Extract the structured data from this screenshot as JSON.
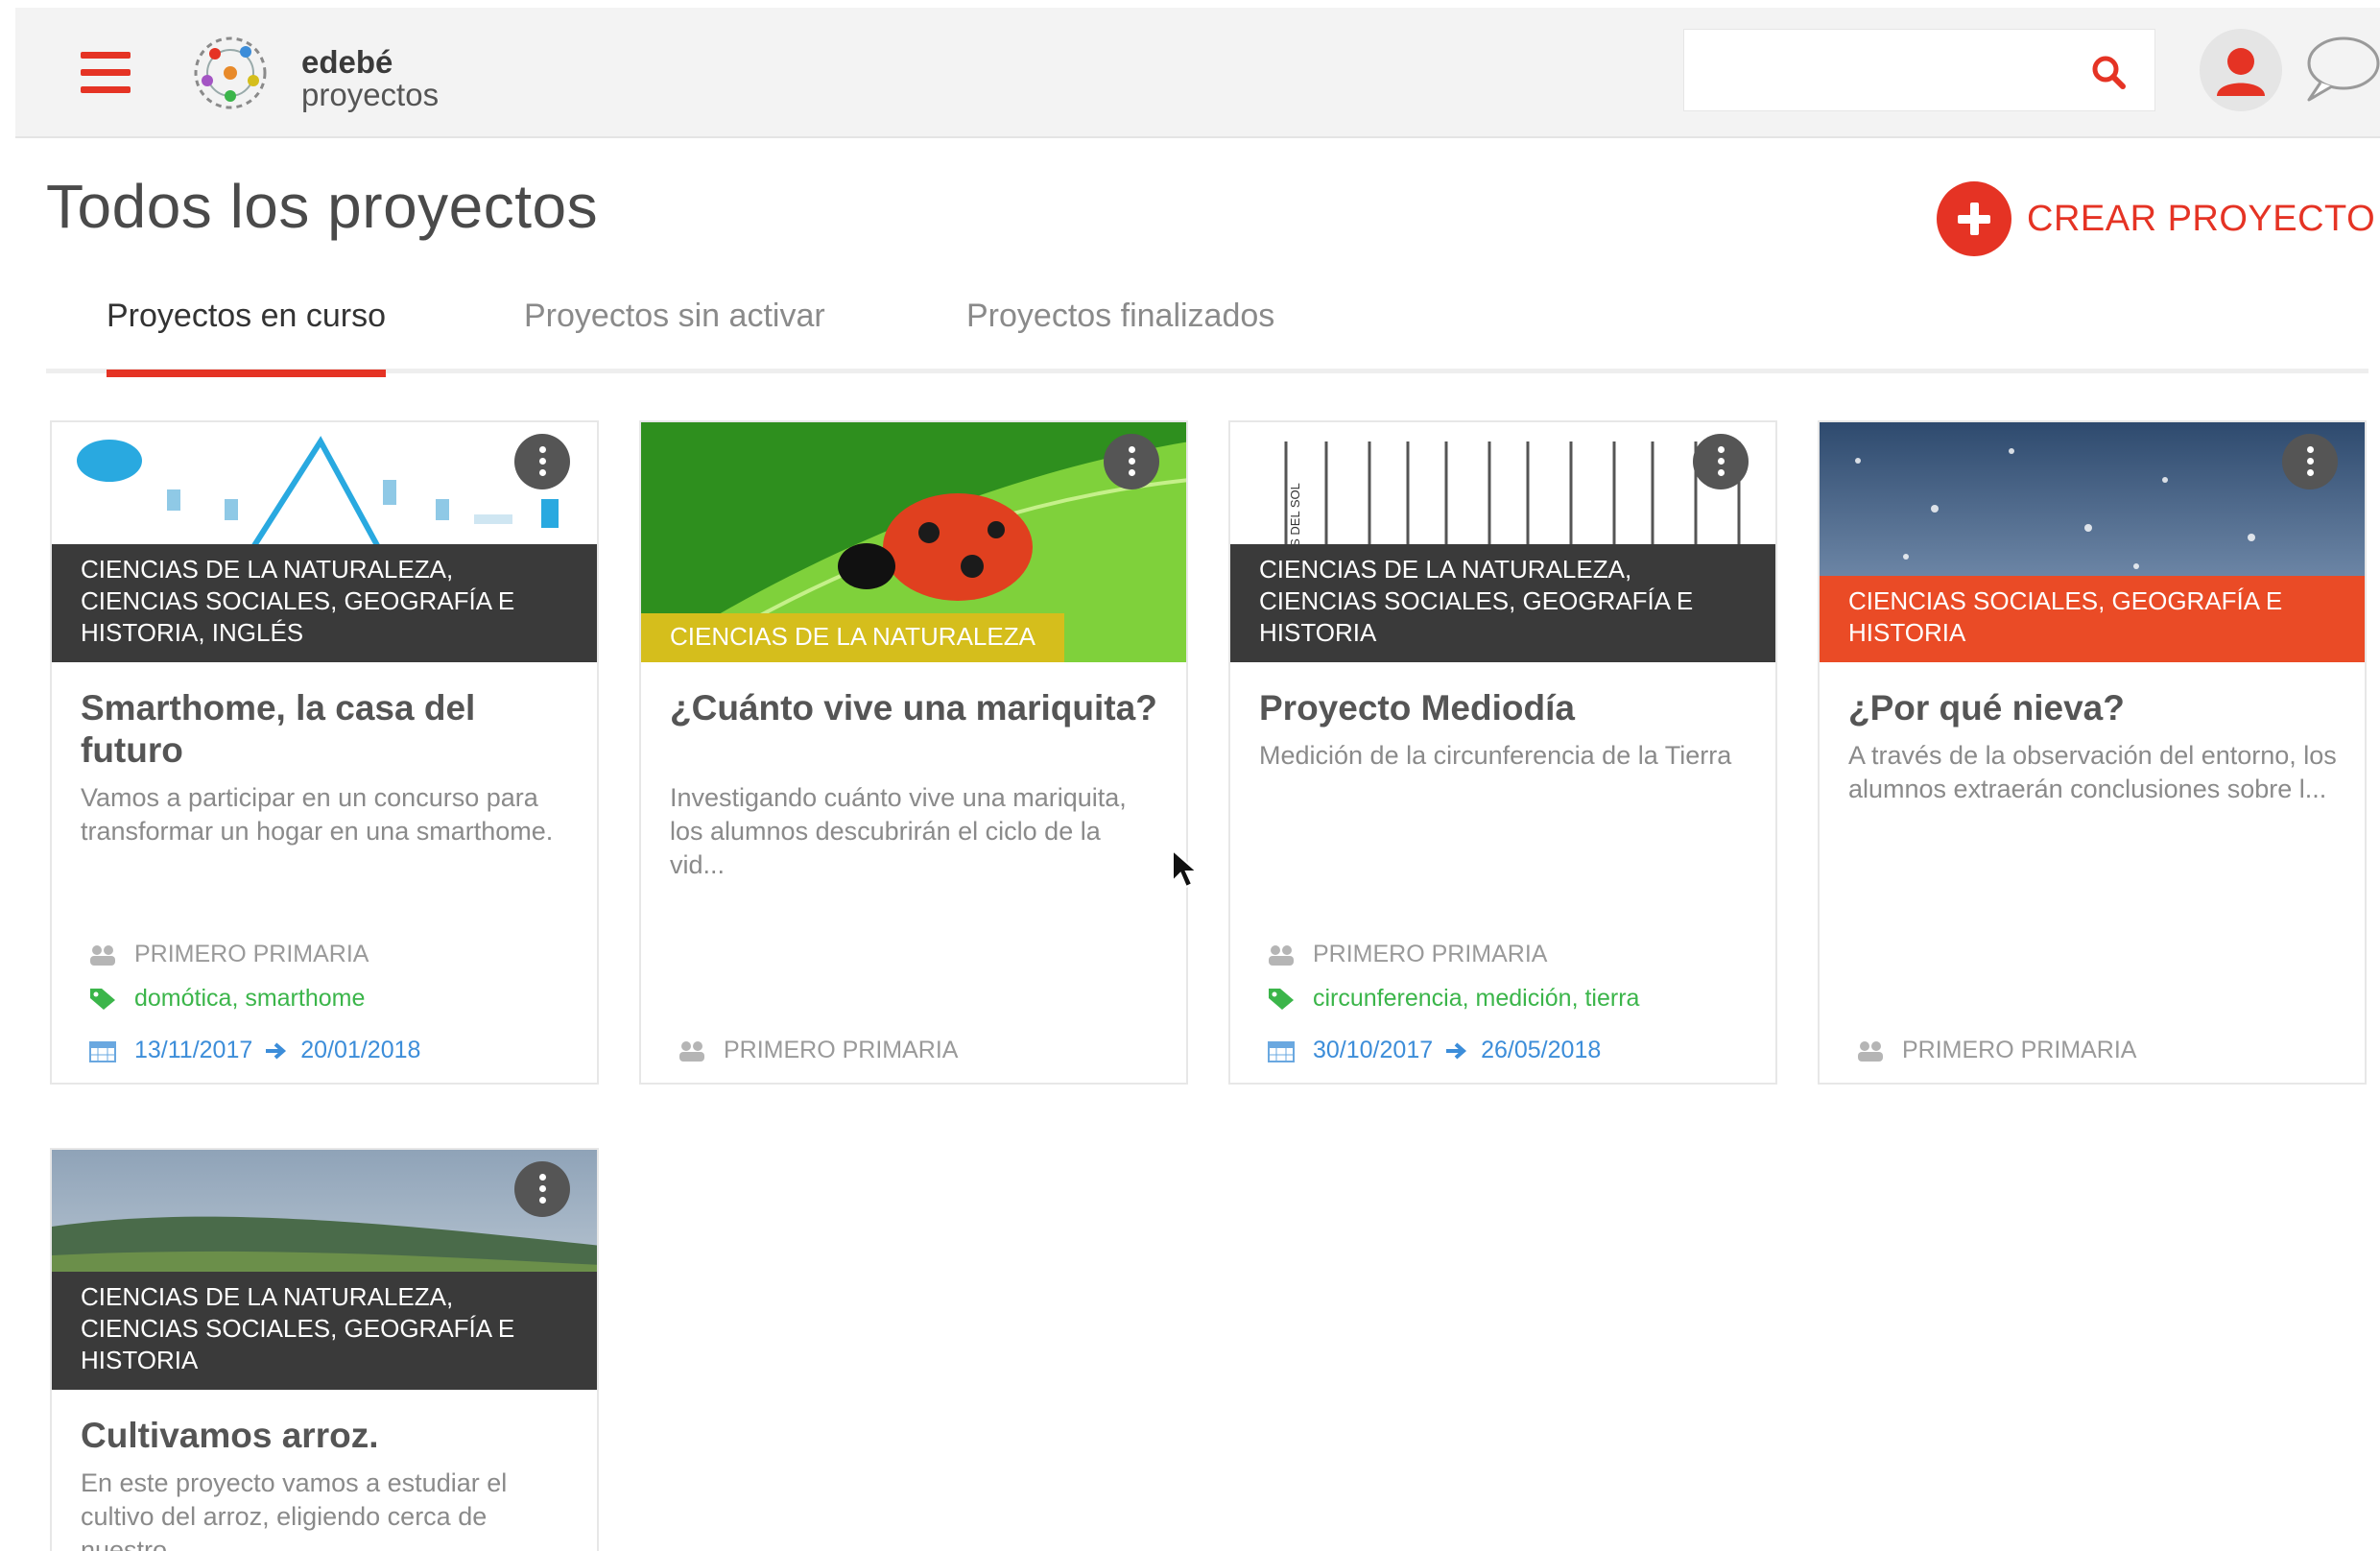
{
  "header": {
    "logo_line1": "edebé",
    "logo_line2": "proyectos",
    "search_placeholder": ""
  },
  "page": {
    "title": "Todos los proyectos",
    "create_label": "CREAR PROYECTO"
  },
  "tabs": [
    {
      "label": "Proyectos en curso",
      "active": true
    },
    {
      "label": "Proyectos sin activar",
      "active": false
    },
    {
      "label": "Proyectos finalizados",
      "active": false
    }
  ],
  "colors": {
    "accent": "#e53324",
    "band_dark": "#3a3a3a",
    "band_yellow": "#d5be1c",
    "band_red": "#ea4b26",
    "tags_green": "#3bb54a",
    "dates_blue": "#3c8dd9"
  },
  "cards": [
    {
      "subjects": "CIENCIAS DE LA NATURALEZA, CIENCIAS SOCIALES, GEOGRAFÍA E HISTORIA, INGLÉS",
      "title": "Smarthome, la casa del futuro",
      "description": "Vamos a participar en un concurso para transformar un hogar en una smarthome.",
      "level": "PRIMERO PRIMARIA",
      "tags": "domótica, smarthome",
      "date_start": "13/11/2017",
      "date_end": "20/01/2018"
    },
    {
      "subjects": "CIENCIAS DE LA NATURALEZA",
      "title": "¿Cuánto vive una mariquita?",
      "description": "Investigando cuánto vive una mariquita, los alumnos descubrirán el ciclo de la vid...",
      "level": "PRIMERO PRIMARIA"
    },
    {
      "subjects": "CIENCIAS DE LA NATURALEZA, CIENCIAS SOCIALES, GEOGRAFÍA E HISTORIA",
      "image_text": "OS DEL SOL",
      "title": "Proyecto Mediodía",
      "description": "Medición de la circunferencia de la Tierra",
      "level": "PRIMERO PRIMARIA",
      "tags": "circunferencia, medición, tierra",
      "date_start": "30/10/2017",
      "date_end": "26/05/2018"
    },
    {
      "subjects": "CIENCIAS SOCIALES, GEOGRAFÍA E HISTORIA",
      "title": "¿Por qué nieva?",
      "description": "A través de la observación del entorno, los alumnos extraerán conclusiones sobre l...",
      "level": "PRIMERO PRIMARIA"
    },
    {
      "subjects": "CIENCIAS DE LA NATURALEZA, CIENCIAS SOCIALES, GEOGRAFÍA E HISTORIA",
      "title": "Cultivamos arroz.",
      "description": "En este proyecto vamos a estudiar el cultivo del arroz, eligiendo cerca de nuestro..."
    }
  ]
}
